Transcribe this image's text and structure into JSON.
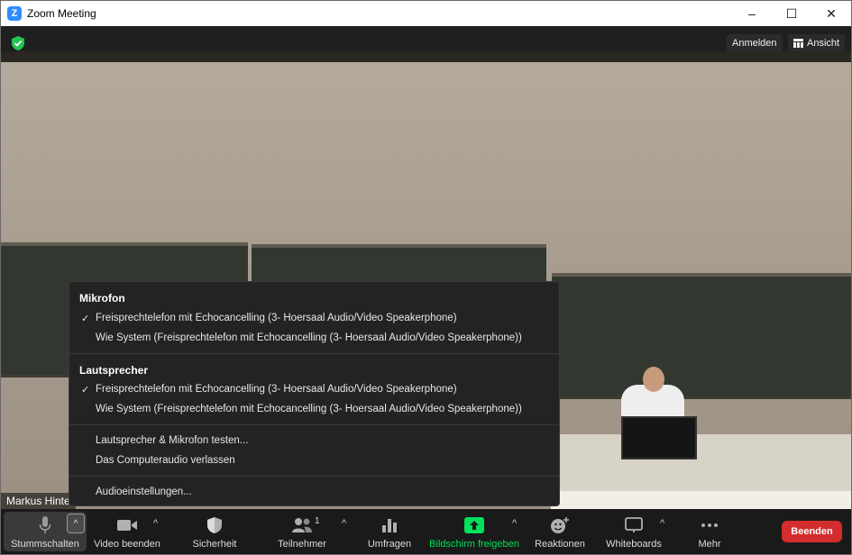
{
  "window": {
    "app_icon": "Z",
    "title": "Zoom Meeting",
    "controls": [
      "–",
      "☐",
      "✕"
    ]
  },
  "topbar": {
    "signin_label": "Anmelden",
    "view_label": "Ansicht",
    "security_shield_color": "#23c552"
  },
  "video": {
    "participant_name": "Markus Hinte"
  },
  "audio_menu": {
    "microphone_heading": "Mikrofon",
    "microphone_options": [
      {
        "label": "Freisprechtelefon mit Echocancelling (3- Hoersaal Audio/Video Speakerphone)",
        "selected": true
      },
      {
        "label": "Wie System (Freisprechtelefon mit Echocancelling (3- Hoersaal Audio/Video Speakerphone))",
        "selected": false
      }
    ],
    "speaker_heading": "Lautsprecher",
    "speaker_options": [
      {
        "label": "Freisprechtelefon mit Echocancelling (3- Hoersaal Audio/Video Speakerphone)",
        "selected": true
      },
      {
        "label": "Wie System (Freisprechtelefon mit Echocancelling (3- Hoersaal Audio/Video Speakerphone))",
        "selected": false
      }
    ],
    "check_glyph": "✓",
    "test_label": "Lautsprecher & Mikrofon testen...",
    "leave_audio_label": "Das Computeraudio verlassen",
    "settings_label": "Audioeinstellungen..."
  },
  "toolbar": {
    "mute_label": "Stummschalten",
    "video_label": "Video beenden",
    "security_label": "Sicherheit",
    "participants_label": "Teilnehmer",
    "participants_count": "1",
    "polls_label": "Umfragen",
    "share_label": "Bildschirm freigeben",
    "reactions_label": "Reaktionen",
    "whiteboards_label": "Whiteboards",
    "more_label": "Mehr",
    "end_label": "Beenden",
    "caret_glyph": "^",
    "share_color": "#00e05a",
    "end_color": "#d32d2d"
  }
}
